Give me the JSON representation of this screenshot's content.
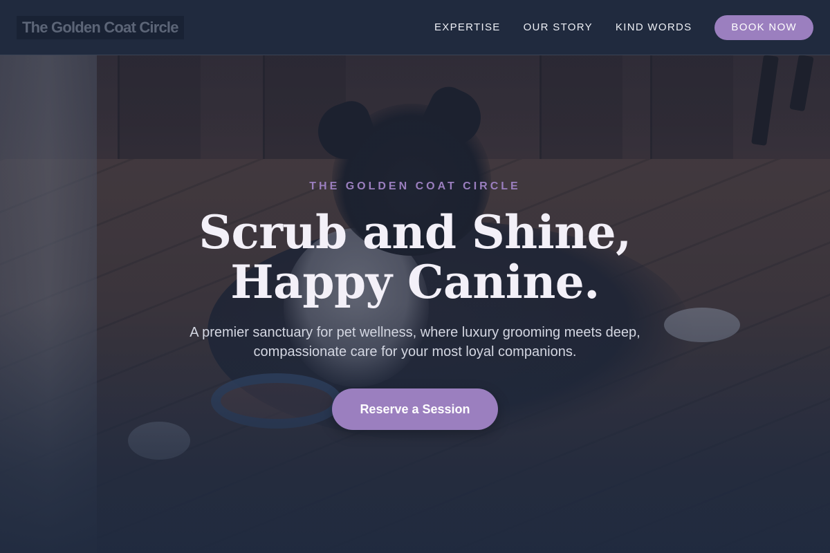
{
  "nav": {
    "brand": "The Golden Coat Circle",
    "links": [
      {
        "label": "EXPERTISE"
      },
      {
        "label": "OUR STORY"
      },
      {
        "label": "KIND WORDS"
      }
    ],
    "cta_label": "BOOK NOW"
  },
  "hero": {
    "eyebrow": "THE GOLDEN COAT CIRCLE",
    "headline_line1": "Scrub and Shine,",
    "headline_line2": "Happy Canine.",
    "subtext": "A premier sanctuary for pet wellness, where luxury grooming meets deep, compassionate care for your most loyal companions.",
    "cta_label": "Reserve a Session",
    "background_image_alt": "dog lying on a wooden floor"
  },
  "colors": {
    "accent": "#9b7fbf",
    "navy": "#1f2a3f",
    "headline": "#f3f0f8"
  }
}
